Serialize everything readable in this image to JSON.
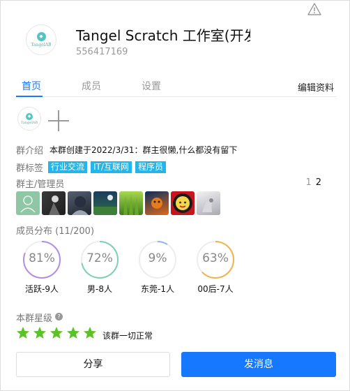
{
  "group": {
    "logo_text": "TangelAB",
    "title": "Tangel Scratch 工作室(开发群",
    "id": "556417169"
  },
  "tabs": [
    "首页",
    "成员",
    "设置"
  ],
  "edit_label": "编辑资料",
  "intro": {
    "label": "群介绍",
    "text": "本群创建于2022/3/31：群主很懒,什么都没有留下"
  },
  "tag_row": {
    "label": "群标签",
    "tags": [
      "行业交流",
      "IT/互联网",
      "程序员"
    ]
  },
  "admins": {
    "label": "群主/管理员",
    "page_current": "1",
    "page_total": "2"
  },
  "members": {
    "label": "成员分布 (11/200)",
    "stats": [
      {
        "pct_label": "81%",
        "pct": 81,
        "caption": "活跃-9人",
        "color": "#b18ee6"
      },
      {
        "pct_label": "72%",
        "pct": 72,
        "caption": "男-8人",
        "color": "#7bd2b0"
      },
      {
        "pct_label": "9%",
        "pct": 9,
        "caption": "东莞-1人",
        "color": "#8db8ea"
      },
      {
        "pct_label": "63%",
        "pct": 63,
        "caption": "00后-7人",
        "color": "#f4b24a"
      }
    ]
  },
  "rating": {
    "label": "本群星级",
    "stars": 5,
    "text": "该群一切正常"
  },
  "buttons": {
    "share": "分享",
    "message": "发消息"
  },
  "colors": {
    "accent": "#1677ff",
    "tag": "#25b5e8",
    "star": "#5ac325"
  }
}
